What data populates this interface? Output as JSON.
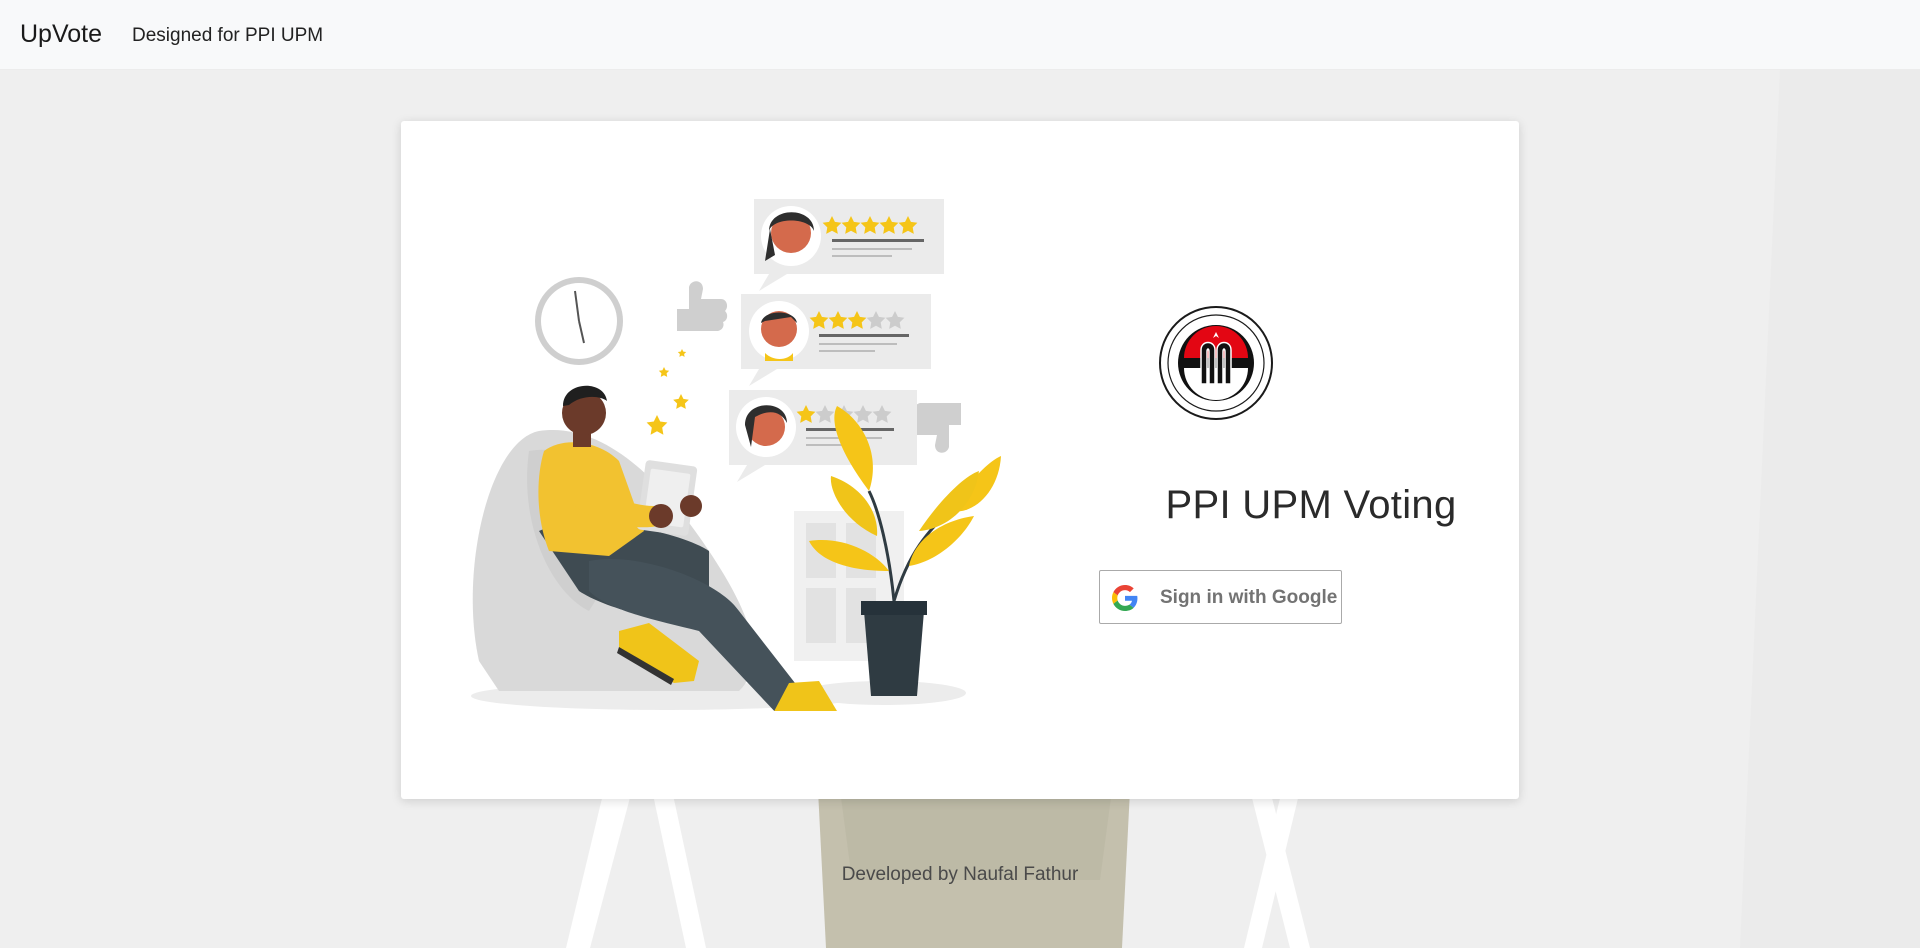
{
  "navbar": {
    "brand": "UpVote",
    "tagline": "Designed for PPI UPM"
  },
  "card": {
    "title": "PPI UPM Voting",
    "signin_label": "Sign in with Google"
  },
  "footer": {
    "text": "Developed by Naufal Fathur"
  },
  "illustration": {
    "reviews": [
      {
        "rating": 5,
        "max": 5
      },
      {
        "rating": 3,
        "max": 5
      },
      {
        "rating": 1,
        "max": 5
      }
    ]
  },
  "icons": {
    "google": "google-g-icon",
    "logo": "ppi-upm-seal"
  },
  "colors": {
    "accent_yellow": "#f5c518",
    "navbar_bg": "#f8f9fa",
    "card_bg": "#ffffff",
    "logo_red": "#e30613"
  }
}
